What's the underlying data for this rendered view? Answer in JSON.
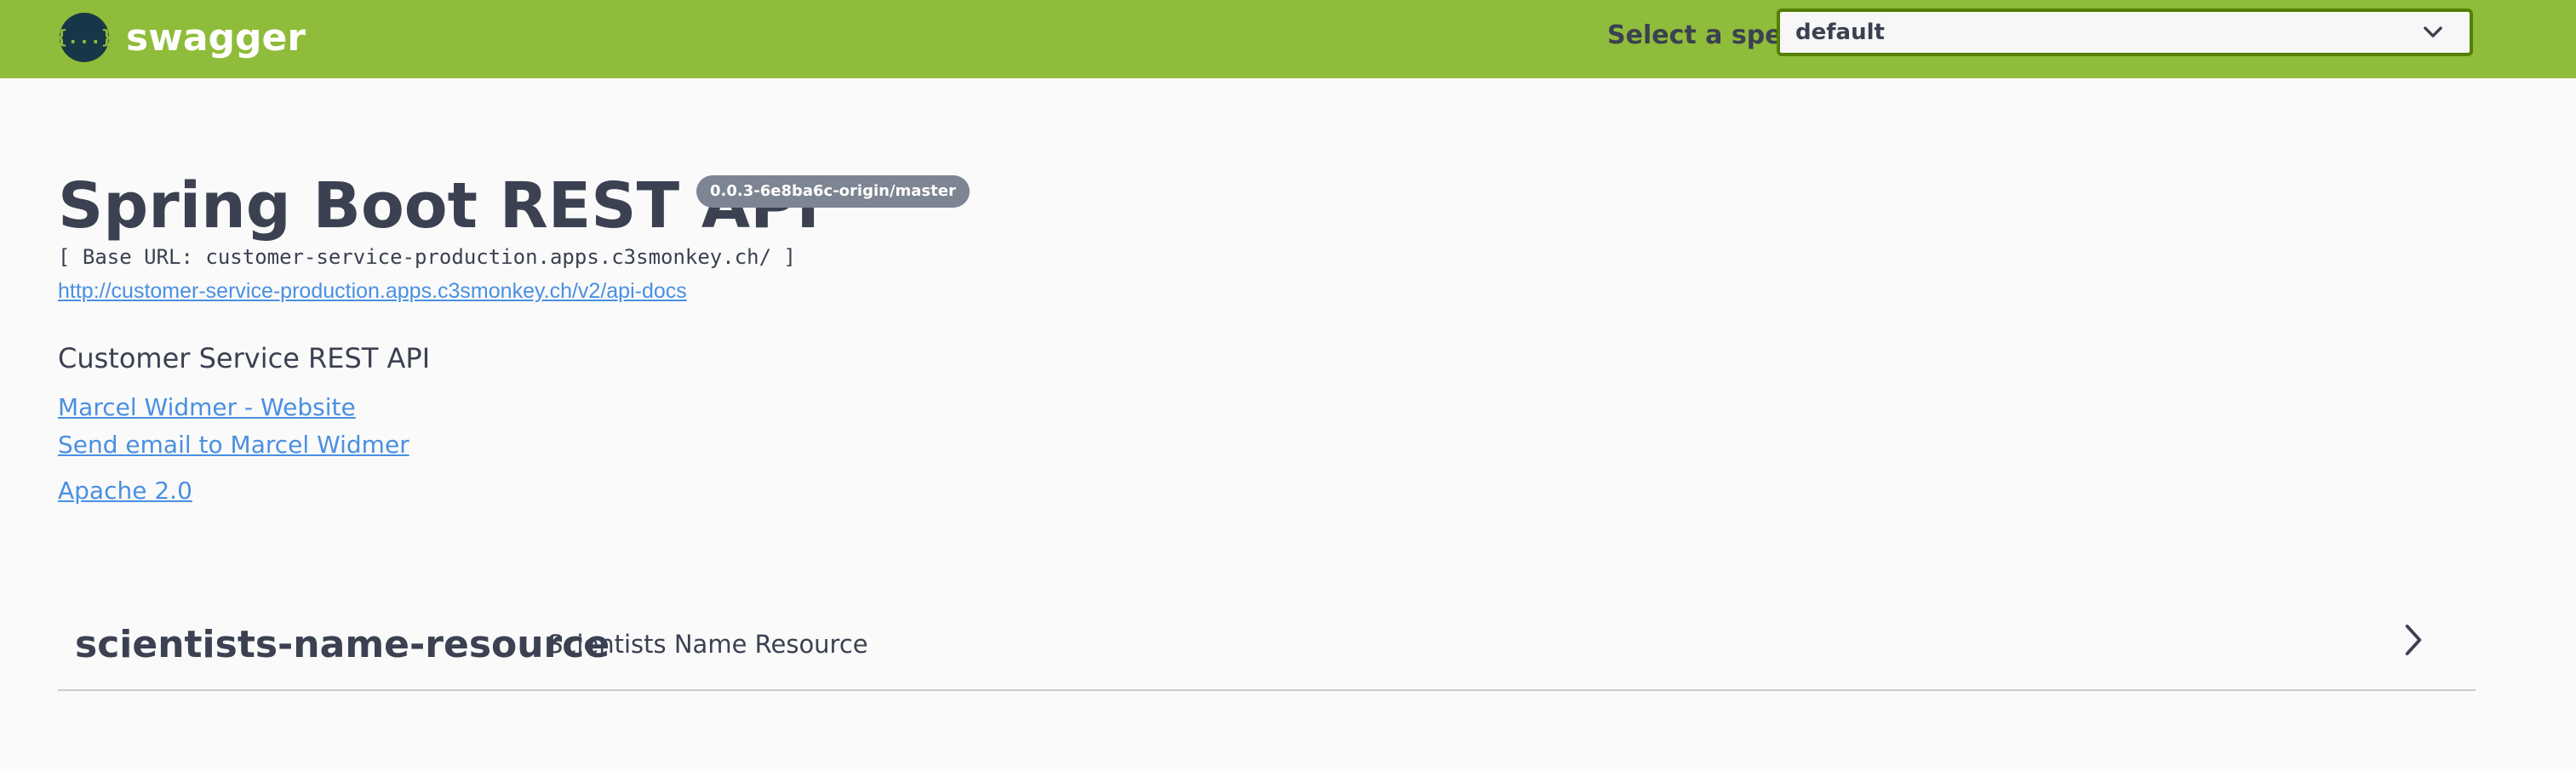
{
  "topbar": {
    "logo_text": "swagger",
    "logo_icon_glyph": "{...}",
    "spec_label": "Select a spec",
    "spec_selected": "default"
  },
  "info": {
    "title": "Spring Boot REST API",
    "version": "0.0.3-6e8ba6c-origin/master",
    "base_url": "[ Base URL: customer-service-production.apps.c3smonkey.ch/ ]",
    "api_docs_link": "http://customer-service-production.apps.c3smonkey.ch/v2/api-docs",
    "description": "Customer Service REST API",
    "contact_website": "Marcel Widmer - Website",
    "contact_email": "Send email to Marcel Widmer",
    "license": "Apache 2.0"
  },
  "tags": [
    {
      "name": "scientists-name-resource",
      "description": "Scientists Name Resource"
    }
  ],
  "colors": {
    "topbar_bg": "#8fbc3a",
    "select_border": "#547f00",
    "link": "#4990e2",
    "text": "#3b4151",
    "version_badge": "#7d8492"
  }
}
